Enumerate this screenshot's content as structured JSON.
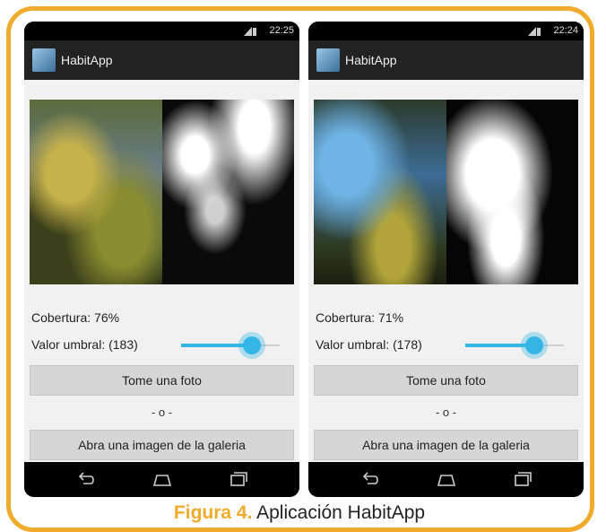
{
  "caption": {
    "figure_label": "Figura 4.",
    "text": "Aplicación HabitApp"
  },
  "colors": {
    "frame": "#f0ab2d",
    "slider_accent": "#33b5e5",
    "action_bar": "#222222"
  },
  "screens": [
    {
      "status_time": "22:25",
      "app_title": "HabitApp",
      "cobertura_label": "Cobertura:",
      "cobertura_value": "76%",
      "umbral_label": "Valor umbral:",
      "umbral_value": "(183)",
      "slider_level": 0.72,
      "button_photo": "Tome una foto",
      "separator": "- o -",
      "button_gallery": "Abra una imagen de la galeria"
    },
    {
      "status_time": "22:24",
      "app_title": "HabitApp",
      "cobertura_label": "Cobertura:",
      "cobertura_value": "71%",
      "umbral_label": "Valor umbral:",
      "umbral_value": "(178)",
      "slider_level": 0.7,
      "button_photo": "Tome una foto",
      "separator": "- o -",
      "button_gallery": "Abra una imagen de la galeria"
    }
  ],
  "icons": [
    "signal-icon",
    "battery-icon",
    "app-logo-icon",
    "back-icon",
    "home-icon",
    "recents-icon"
  ]
}
